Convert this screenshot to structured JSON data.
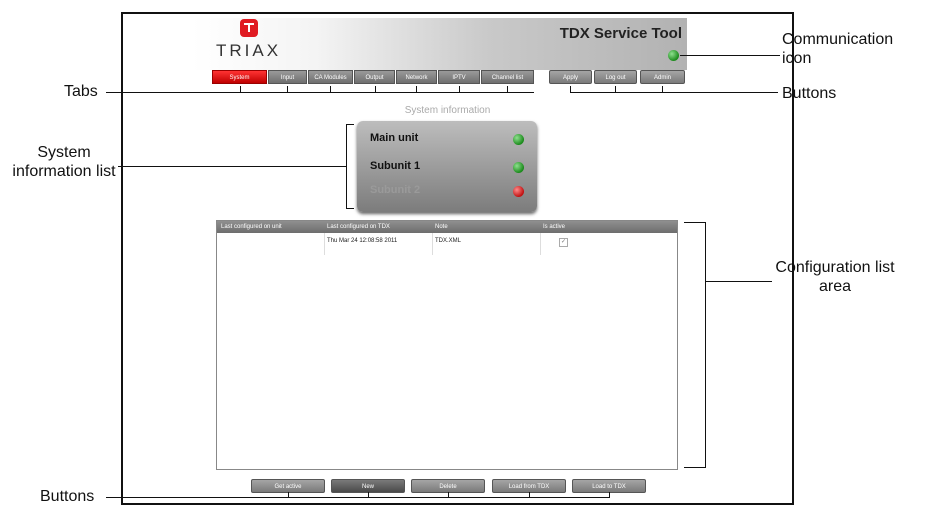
{
  "app": {
    "brand": "TRIAX",
    "title": "TDX Service Tool"
  },
  "tabs": [
    {
      "label": "System",
      "active": true
    },
    {
      "label": "Input",
      "active": false
    },
    {
      "label": "CA Modules",
      "active": false
    },
    {
      "label": "Output",
      "active": false
    },
    {
      "label": "Network",
      "active": false
    },
    {
      "label": "IPTV",
      "active": false
    },
    {
      "label": "Channel list",
      "active": false
    }
  ],
  "top_buttons": [
    "Apply",
    "Log out",
    "Admin"
  ],
  "system_info": {
    "title": "System information",
    "units": [
      {
        "name": "Main unit",
        "status": "green"
      },
      {
        "name": "Subunit 1",
        "status": "green"
      },
      {
        "name": "Subunit 2",
        "status": "red"
      }
    ]
  },
  "config_table": {
    "columns": [
      "Last configured on unit",
      "Last configured on TDX",
      "Note",
      "Is active"
    ],
    "rows": [
      {
        "unit": "",
        "tdx": "Thu Mar 24 12:08:58 2011",
        "note": "TDX.XML",
        "active": true
      }
    ]
  },
  "bottom_buttons": [
    "Get active",
    "New",
    "Delete",
    "Load from TDX",
    "Load to TDX"
  ],
  "callouts": {
    "communication_icon": "Communication icon",
    "tabs": "Tabs",
    "buttons_top": "Buttons",
    "system_information_list": "System information list",
    "configuration_list_area": "Configuration list area",
    "buttons_bottom": "Buttons"
  },
  "colors": {
    "accent": "#e01b22",
    "status_green": "#1b8a1b",
    "status_red": "#c01010"
  }
}
